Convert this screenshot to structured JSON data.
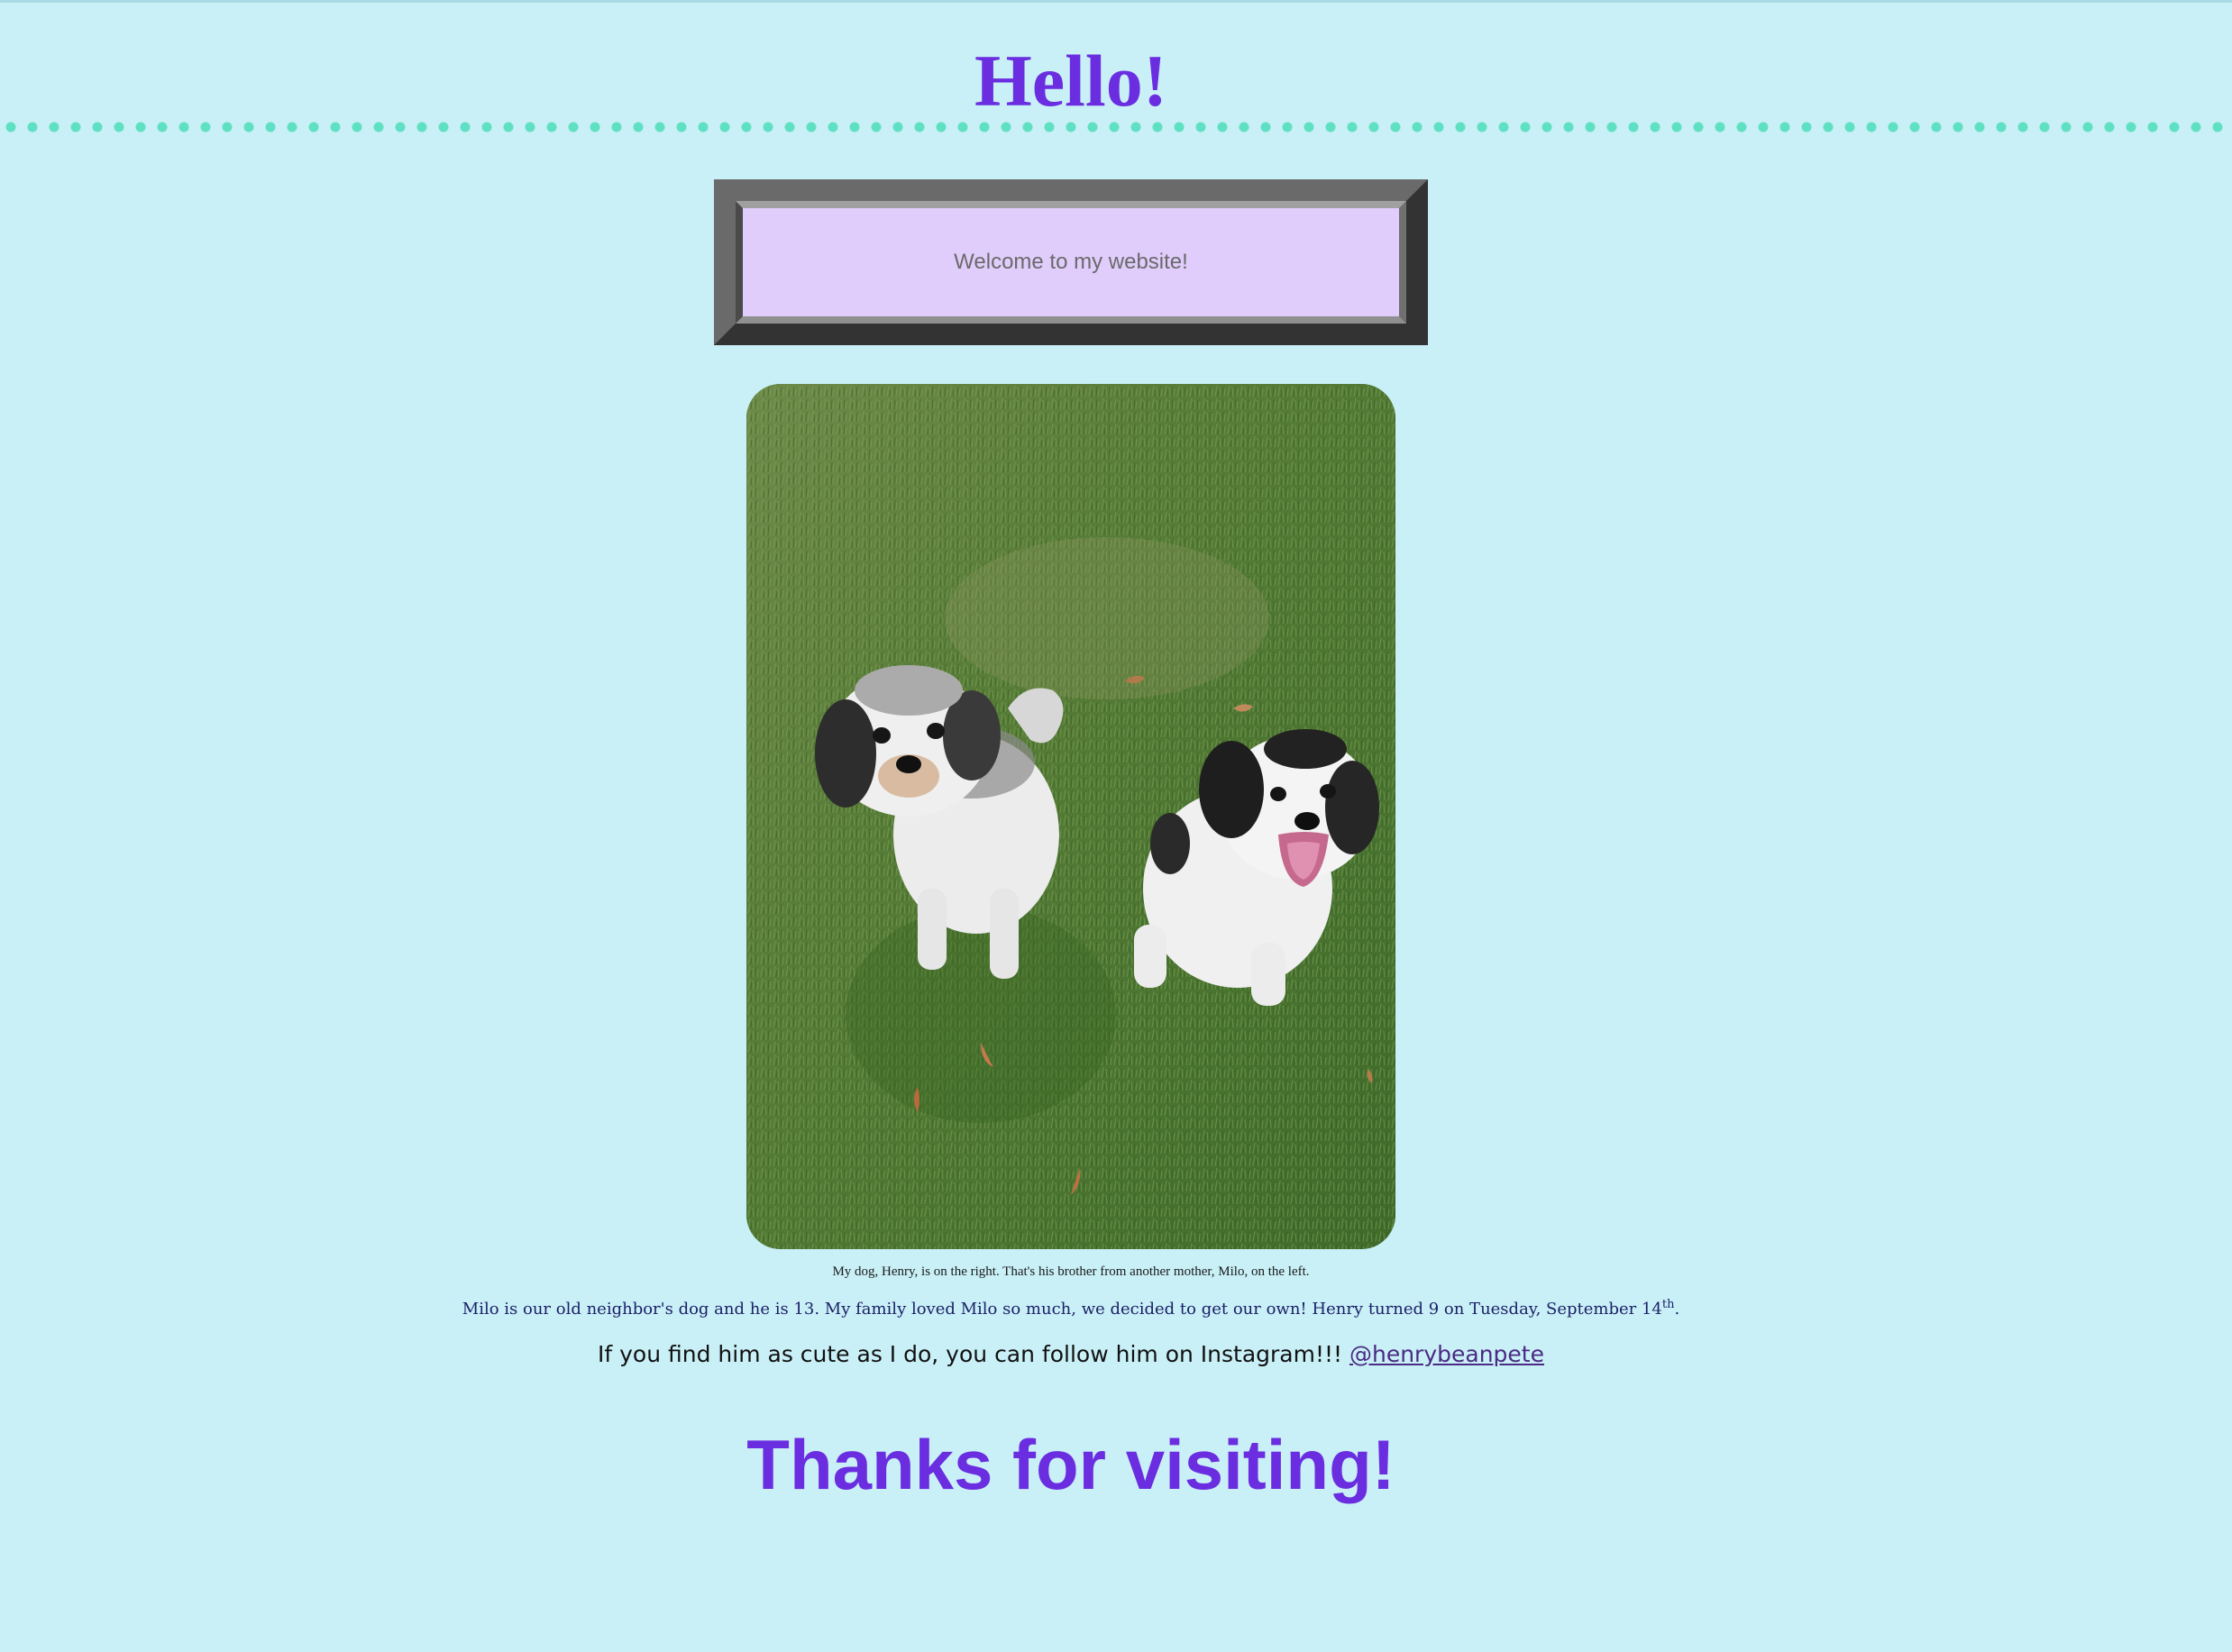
{
  "header": {
    "title": "Hello!"
  },
  "welcome": {
    "text": "Welcome to my website!"
  },
  "photo": {
    "subject": "two white-and-black dogs sitting on grass"
  },
  "caption": {
    "text": "My dog, Henry, is on the right. That's his brother from another mother, Milo, on the left."
  },
  "story": {
    "text": "Milo is our old neighbor's dog and he is 13. My family loved Milo so much, we decided to get our own! Henry turned 9 on Tuesday, September 14",
    "suffix": "th",
    "end": "."
  },
  "instagram": {
    "text": "If you find him as cute as I do, you can follow him on Instagram!!! ",
    "handle": "@henrybeanpete"
  },
  "footer": {
    "thanks": "Thanks for visiting!"
  },
  "colors": {
    "background": "#c9f0f7",
    "heading": "#6a2de0",
    "dots": "#5fe0c2",
    "welcome_bg": "#e0cdfc",
    "link": "#4a2a82"
  }
}
